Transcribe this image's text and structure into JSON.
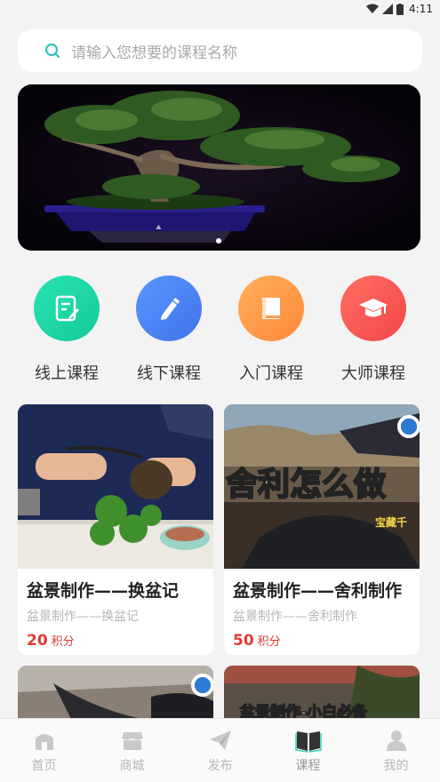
{
  "status_bar": {
    "time": "4:11"
  },
  "search": {
    "placeholder": "请输入您想要的课程名称"
  },
  "categories": [
    {
      "label": "线上课程",
      "color": "#1fd9a6",
      "icon": "document-edit-icon"
    },
    {
      "label": "线下课程",
      "color": "#4f86f5",
      "icon": "pencil-icon"
    },
    {
      "label": "入门课程",
      "color": "#ff9a4b",
      "icon": "book-icon"
    },
    {
      "label": "大师课程",
      "color": "#ff5a57",
      "icon": "graduation-cap-icon"
    }
  ],
  "courses": [
    {
      "title": "盆景制作——换盆记",
      "subtitle": "盆景制作——换盆记",
      "points": "20",
      "points_unit": "积分"
    },
    {
      "title": "盆景制作——舍利制作",
      "subtitle": "盆景制作——舍利制作",
      "points": "50",
      "points_unit": "积分",
      "thumb_text": "舍利怎么做",
      "thumb_small_text": "宝藏千"
    }
  ],
  "partial_cards": [
    {
      "thumb_text": ""
    },
    {
      "thumb_text": "盆景制作-小白必备"
    }
  ],
  "tabbar": [
    {
      "label": "首页",
      "icon": "home-icon"
    },
    {
      "label": "商城",
      "icon": "shop-icon"
    },
    {
      "label": "发布",
      "icon": "send-icon"
    },
    {
      "label": "课程",
      "icon": "open-book-icon",
      "active": true
    },
    {
      "label": "我的",
      "icon": "user-icon"
    }
  ]
}
